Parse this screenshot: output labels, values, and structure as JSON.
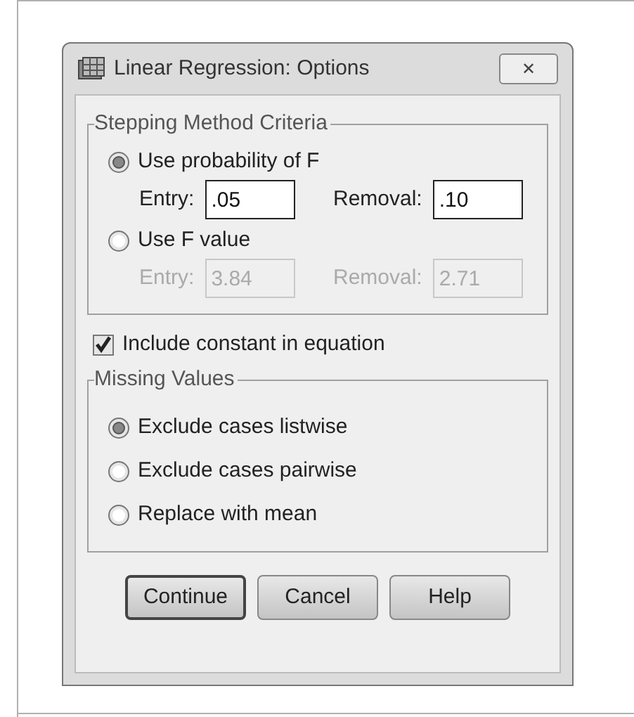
{
  "window": {
    "title": "Linear Regression: Options",
    "close": "✕"
  },
  "stepping": {
    "title": "Stepping Method Criteria",
    "options": [
      {
        "label": "Use probability of F",
        "selected": true,
        "fields": [
          {
            "label": "Entry:",
            "value": ".05",
            "disabled": false
          },
          {
            "label": "Removal:",
            "value": ".10",
            "disabled": false
          }
        ]
      },
      {
        "label": "Use F value",
        "selected": false,
        "fields": [
          {
            "label": "Entry:",
            "value": "3.84",
            "disabled": true
          },
          {
            "label": "Removal:",
            "value": "2.71",
            "disabled": true
          }
        ]
      }
    ]
  },
  "include_constant": {
    "label": "Include constant in equation",
    "checked": true
  },
  "missing": {
    "title": "Missing Values",
    "options": [
      {
        "label": "Exclude cases listwise",
        "selected": true
      },
      {
        "label": "Exclude cases pairwise",
        "selected": false
      },
      {
        "label": "Replace with mean",
        "selected": false
      }
    ]
  },
  "buttons": [
    {
      "label": "Continue",
      "default": true
    },
    {
      "label": "Cancel",
      "default": false
    },
    {
      "label": "Help",
      "default": false
    }
  ]
}
